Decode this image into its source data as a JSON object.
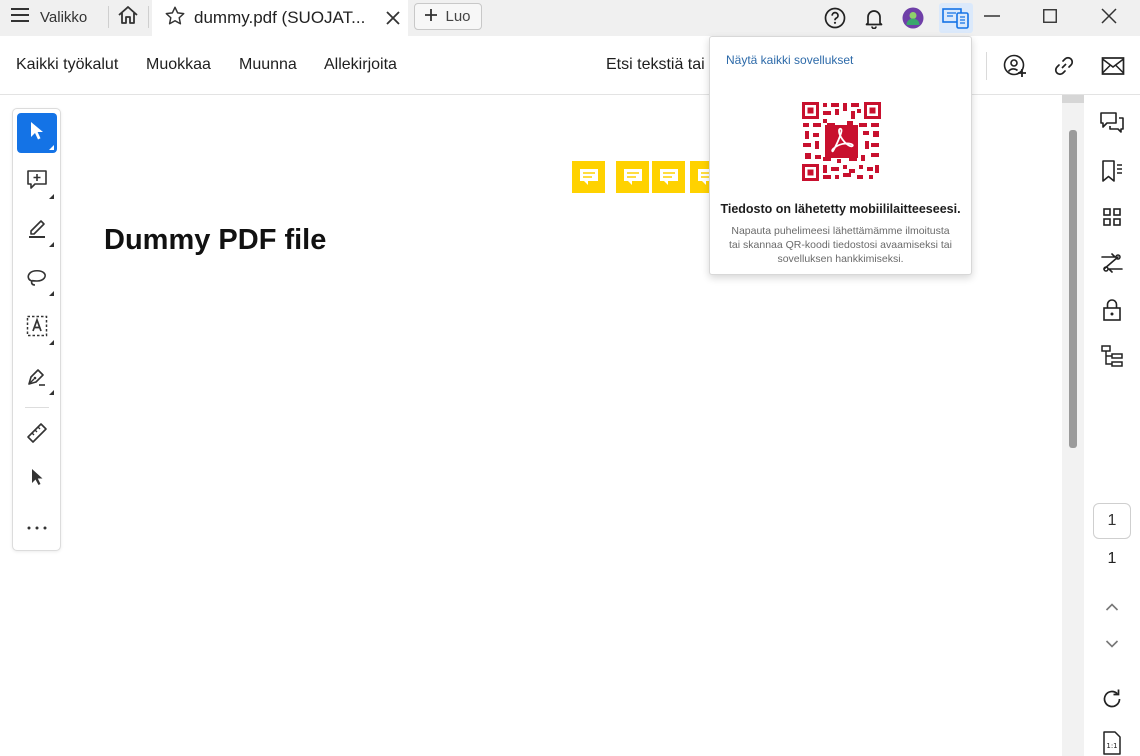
{
  "titlebar": {
    "menu_label": "Valikko",
    "tab_title": "dummy.pdf (SUOJAT...",
    "new_label": "Luo"
  },
  "toolbar": {
    "menu": [
      "Kaikki työkalut",
      "Muokkaa",
      "Muunna",
      "Allekirjoita"
    ],
    "search_label": "Etsi tekstiä tai"
  },
  "document": {
    "title": "Dummy PDF file",
    "comment_count": 4
  },
  "page_nav": {
    "current_page": "1",
    "total_pages": "1"
  },
  "popup": {
    "show_all_link": "Näytä kaikki sovellukset",
    "heading": "Tiedosto on lähetetty mobiililaitteeseesi.",
    "description": "Napauta puhelimeesi lähettämämme ilmoitusta tai skannaa QR-koodi tiedostosi avaamiseksi tai sovelluksen hankkimiseksi."
  },
  "colors": {
    "accent": "#1473e6",
    "note_yellow": "#ffd200",
    "qr_red": "#c8102e",
    "link": "#2d6aa9"
  },
  "icons": {
    "left_rail": [
      "select-arrow-icon",
      "add-comment-icon",
      "highlight-pen-icon",
      "lasso-icon",
      "text-field-icon",
      "draw-pen-icon",
      "measure-ruler-icon",
      "pointer-icon",
      "more-icon"
    ],
    "right_rail": [
      "comments-icon",
      "bookmarks-icon",
      "thumbnails-icon",
      "compare-icon",
      "protect-icon",
      "structure-icon",
      "page-up-icon",
      "page-down-icon",
      "rotate-icon",
      "page-fit-icon"
    ]
  }
}
